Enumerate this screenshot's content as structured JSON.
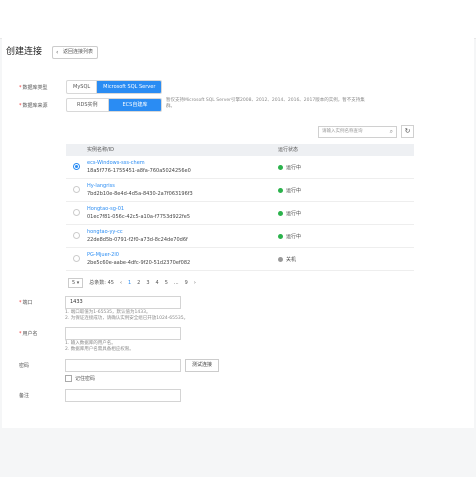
{
  "page": {
    "title": "创建连接",
    "back_label": "返回连接列表"
  },
  "db_type": {
    "label": "数据库类型",
    "options": [
      "MySQL",
      "Microsoft SQL Server"
    ],
    "active": 1
  },
  "db_source": {
    "label": "数据库来源",
    "options": [
      "RDS实例",
      "ECS自建库"
    ],
    "active": 1,
    "hint": "暂仅支持Microsoft SQL Server引擎2008、2012、2014、2016、2017版本的实例，暂不支持集群。"
  },
  "search": {
    "placeholder": "请输入实例名称查询"
  },
  "table": {
    "col_name": "实例名称/ID",
    "col_status": "运行状态",
    "rows": [
      {
        "name": "ecs-Windows-sss-chem",
        "id": "18a5f776-1755451-a8fa-760a5024256e0",
        "status": "运行中",
        "on": true,
        "checked": true
      },
      {
        "name": "Hy-langriss",
        "id": "7bd2b10e-8e4d-4d5a-8430-2a7f063196f3",
        "status": "运行中",
        "on": true,
        "checked": false
      },
      {
        "name": "Hongtao-sg-01",
        "id": "01ec7f81-056c-42c5-a10a-f7753d922fe5",
        "status": "运行中",
        "on": true,
        "checked": false
      },
      {
        "name": "hongtao-yy-cc",
        "id": "22de8d5b-0791-f2f0-a73d-8c24de70d6f",
        "status": "运行中",
        "on": true,
        "checked": false
      },
      {
        "name": "PG-Mjuer-2l0",
        "id": "2be5c60e-aabe-4dfc-9f20-51d2370ef082",
        "status": "关机",
        "on": false,
        "checked": false
      }
    ]
  },
  "pager": {
    "size": "5",
    "total": "总条数: 45",
    "prev": "‹",
    "pages": [
      "1",
      "2",
      "3",
      "4",
      "5",
      "...",
      "9"
    ],
    "next": "›"
  },
  "port": {
    "label": "端口",
    "value": "1433",
    "hint1": "1. 端口取值为1-65535，默认值为1433。",
    "hint2": "2. 为保证连接成功，请确认实例安全组已开放1024-65535。"
  },
  "user": {
    "label": "用户名",
    "hint1": "1. 输入数据库的用户名。",
    "hint2": "2. 数据库用户名需具备相应权限。"
  },
  "password": {
    "label": "密码",
    "test_button": "测试连接"
  },
  "remember": {
    "label": "记住密码"
  },
  "remark": {
    "label": "备注"
  }
}
